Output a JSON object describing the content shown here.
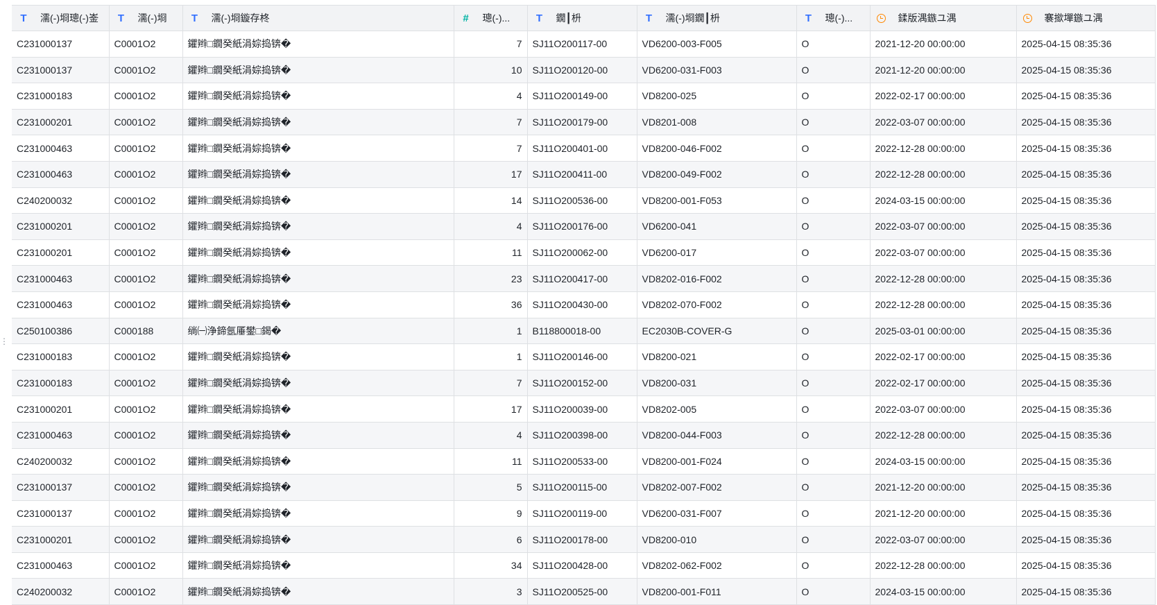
{
  "columns": [
    {
      "label": "濡(-)埛璁(-)崟",
      "icon": "text-type-icon",
      "align": "left"
    },
    {
      "label": "濡(-)埛",
      "icon": "text-type-icon",
      "align": "left"
    },
    {
      "label": "濡(-)埛鏇存柊",
      "icon": "text-type-icon",
      "align": "left"
    },
    {
      "label": "璁(-)...",
      "icon": "number-type-icon",
      "align": "right"
    },
    {
      "label": "鐗┃枡",
      "icon": "text-type-icon",
      "align": "left"
    },
    {
      "label": "濡(-)埛鐗┃枡",
      "icon": "text-type-icon",
      "align": "left"
    },
    {
      "label": "璁(-)...",
      "icon": "text-type-icon",
      "align": "left"
    },
    {
      "label": "鍒版湡鏃ユ湡",
      "icon": "clock-icon",
      "align": "left"
    },
    {
      "label": "褰撳墠鏃ユ湡",
      "icon": "clock-icon",
      "align": "left"
    }
  ],
  "rows": [
    [
      "C231000137",
      "C0001O2",
      "鑺辫□鐗癸紙涓婃捣锛�",
      "7",
      "SJ11O200117-00",
      "VD6200-003-F005",
      "O",
      "2021-12-20 00:00:00",
      "2025-04-15 08:35:36"
    ],
    [
      "C231000137",
      "C0001O2",
      "鑺辫□鐗癸紙涓婃捣锛�",
      "10",
      "SJ11O200120-00",
      "VD6200-031-F003",
      "O",
      "2021-12-20 00:00:00",
      "2025-04-15 08:35:36"
    ],
    [
      "C231000183",
      "C0001O2",
      "鑺辫□鐗癸紙涓婃捣锛�",
      "4",
      "SJ11O200149-00",
      "VD8200-025",
      "O",
      "2022-02-17 00:00:00",
      "2025-04-15 08:35:36"
    ],
    [
      "C231000201",
      "C0001O2",
      "鑺辫□鐗癸紙涓婃捣锛�",
      "7",
      "SJ11O200179-00",
      "VD8201-008",
      "O",
      "2022-03-07 00:00:00",
      "2025-04-15 08:35:36"
    ],
    [
      "C231000463",
      "C0001O2",
      "鑺辫□鐗癸紙涓婃捣锛�",
      "7",
      "SJ11O200401-00",
      "VD8200-046-F002",
      "O",
      "2022-12-28 00:00:00",
      "2025-04-15 08:35:36"
    ],
    [
      "C231000463",
      "C0001O2",
      "鑺辫□鐗癸紙涓婃捣锛�",
      "17",
      "SJ11O200411-00",
      "VD8200-049-F002",
      "O",
      "2022-12-28 00:00:00",
      "2025-04-15 08:35:36"
    ],
    [
      "C240200032",
      "C0001O2",
      "鑺辫□鐗癸紙涓婃捣锛�",
      "14",
      "SJ11O200536-00",
      "VD8200-001-F053",
      "O",
      "2024-03-15 00:00:00",
      "2025-04-15 08:35:36"
    ],
    [
      "C231000201",
      "C0001O2",
      "鑺辫□鐗癸紙涓婃捣锛�",
      "4",
      "SJ11O200176-00",
      "VD6200-041",
      "O",
      "2022-03-07 00:00:00",
      "2025-04-15 08:35:36"
    ],
    [
      "C231000201",
      "C0001O2",
      "鑺辫□鐗癸紙涓婃捣锛�",
      "11",
      "SJ11O200062-00",
      "VD6200-017",
      "O",
      "2022-03-07 00:00:00",
      "2025-04-15 08:35:36"
    ],
    [
      "C231000463",
      "C0001O2",
      "鑺辫□鐗癸紙涓婃捣锛�",
      "23",
      "SJ11O200417-00",
      "VD8202-016-F002",
      "O",
      "2022-12-28 00:00:00",
      "2025-04-15 08:35:36"
    ],
    [
      "C231000463",
      "C0001O2",
      "鑺辫□鐗癸紙涓婃捣锛�",
      "36",
      "SJ11O200430-00",
      "VD8202-070-F002",
      "O",
      "2022-12-28 00:00:00",
      "2025-04-15 08:35:36"
    ],
    [
      "C250100386",
      "C000188",
      "绱㈠浄鍗氬厜鐢□鍻�",
      "1",
      "B118800018-00",
      "EC2030B-COVER-G",
      "O",
      "2025-03-01 00:00:00",
      "2025-04-15 08:35:36"
    ],
    [
      "C231000183",
      "C0001O2",
      "鑺辫□鐗癸紙涓婃捣锛�",
      "1",
      "SJ11O200146-00",
      "VD8200-021",
      "O",
      "2022-02-17 00:00:00",
      "2025-04-15 08:35:36"
    ],
    [
      "C231000183",
      "C0001O2",
      "鑺辫□鐗癸紙涓婃捣锛�",
      "7",
      "SJ11O200152-00",
      "VD8200-031",
      "O",
      "2022-02-17 00:00:00",
      "2025-04-15 08:35:36"
    ],
    [
      "C231000201",
      "C0001O2",
      "鑺辫□鐗癸紙涓婃捣锛�",
      "17",
      "SJ11O200039-00",
      "VD8202-005",
      "O",
      "2022-03-07 00:00:00",
      "2025-04-15 08:35:36"
    ],
    [
      "C231000463",
      "C0001O2",
      "鑺辫□鐗癸紙涓婃捣锛�",
      "4",
      "SJ11O200398-00",
      "VD8200-044-F003",
      "O",
      "2022-12-28 00:00:00",
      "2025-04-15 08:35:36"
    ],
    [
      "C240200032",
      "C0001O2",
      "鑺辫□鐗癸紙涓婃捣锛�",
      "11",
      "SJ11O200533-00",
      "VD8200-001-F024",
      "O",
      "2024-03-15 00:00:00",
      "2025-04-15 08:35:36"
    ],
    [
      "C231000137",
      "C0001O2",
      "鑺辫□鐗癸紙涓婃捣锛�",
      "5",
      "SJ11O200115-00",
      "VD8202-007-F002",
      "O",
      "2021-12-20 00:00:00",
      "2025-04-15 08:35:36"
    ],
    [
      "C231000137",
      "C0001O2",
      "鑺辫□鐗癸紙涓婃捣锛�",
      "9",
      "SJ11O200119-00",
      "VD6200-031-F007",
      "O",
      "2021-12-20 00:00:00",
      "2025-04-15 08:35:36"
    ],
    [
      "C231000201",
      "C0001O2",
      "鑺辫□鐗癸紙涓婃捣锛�",
      "6",
      "SJ11O200178-00",
      "VD8200-010",
      "O",
      "2022-03-07 00:00:00",
      "2025-04-15 08:35:36"
    ],
    [
      "C231000463",
      "C0001O2",
      "鑺辫□鐗癸紙涓婃捣锛�",
      "34",
      "SJ11O200428-00",
      "VD8202-062-F002",
      "O",
      "2022-12-28 00:00:00",
      "2025-04-15 08:35:36"
    ],
    [
      "C240200032",
      "C0001O2",
      "鑺辫□鐗癸紙涓婃捣锛�",
      "3",
      "SJ11O200525-00",
      "VD8200-001-F011",
      "O",
      "2024-03-15 00:00:00",
      "2025-04-15 08:35:36"
    ]
  ],
  "colors": {
    "text_icon": "#3370ff",
    "number_icon": "#00b3a4",
    "time_icon": "#ff8800",
    "header_bg": "#f2f3f5",
    "stripe_bg": "#f5f6f8",
    "border": "#dee0e3"
  }
}
